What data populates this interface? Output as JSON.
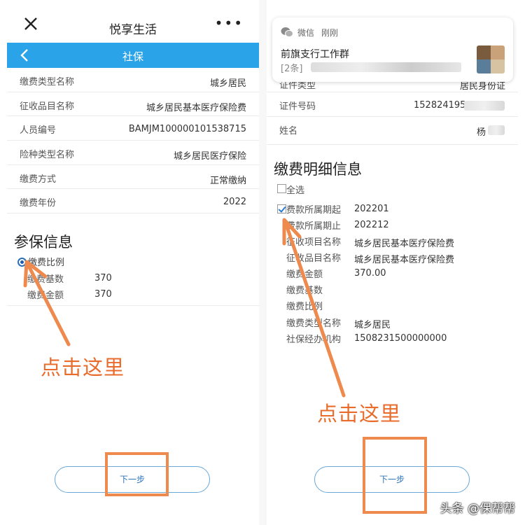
{
  "left": {
    "app_title": "悦享生活",
    "more": "•••",
    "nav_title": "社保",
    "rows": [
      {
        "k": "缴费类型名称",
        "v": "城乡居民"
      },
      {
        "k": "征收品目名称",
        "v": "城乡居民基本医疗保险费"
      },
      {
        "k": "人员编号",
        "v": "BAMJM100000101538715"
      },
      {
        "k": "险种类型名称",
        "v": "城乡居民医疗保险"
      },
      {
        "k": "缴费方式",
        "v": "正常缴纳"
      },
      {
        "k": "缴费年份",
        "v": "2022"
      }
    ],
    "section_title": "参保信息",
    "radio_label": "缴费比例",
    "base_label": "缴费基数",
    "base_value": "370",
    "amount_label": "缴费金额",
    "amount_value": "370",
    "annotation": "点击这里",
    "next": "下一步"
  },
  "right": {
    "notification": {
      "app": "微信",
      "time": "刚刚",
      "group": "前旗支行工作群",
      "msg_prefix": "[2条]"
    },
    "partial_row": {
      "k": "证件类型",
      "v": "居民身份证"
    },
    "id_row": {
      "k": "证件号码",
      "v": "152824195"
    },
    "name_row": {
      "k": "姓名",
      "v": "杨"
    },
    "section_title": "缴费明细信息",
    "select_all": "全选",
    "details": [
      {
        "k": "费款所属期起",
        "v": "202201"
      },
      {
        "k": "费款所属期止",
        "v": "202212"
      },
      {
        "k": "征收项目名称",
        "v": "城乡居民基本医疗保险费"
      },
      {
        "k": "征收品目名称",
        "v": "城乡居民基本医疗保险费"
      },
      {
        "k": "缴费金额",
        "v": "370.00"
      },
      {
        "k": "缴费基数",
        "v": ""
      },
      {
        "k": "缴费比例",
        "v": ""
      },
      {
        "k": "缴费类型名称",
        "v": "城乡居民"
      },
      {
        "k": "社保经办机构",
        "v": "1508231500000000"
      }
    ],
    "annotation": "点击这里",
    "next": "下一步"
  },
  "watermark": "头条 @保帮帮",
  "colors": {
    "nav": "#2aa3e8",
    "annotation": "#e86d2c",
    "button_text": "#2b74b8"
  }
}
